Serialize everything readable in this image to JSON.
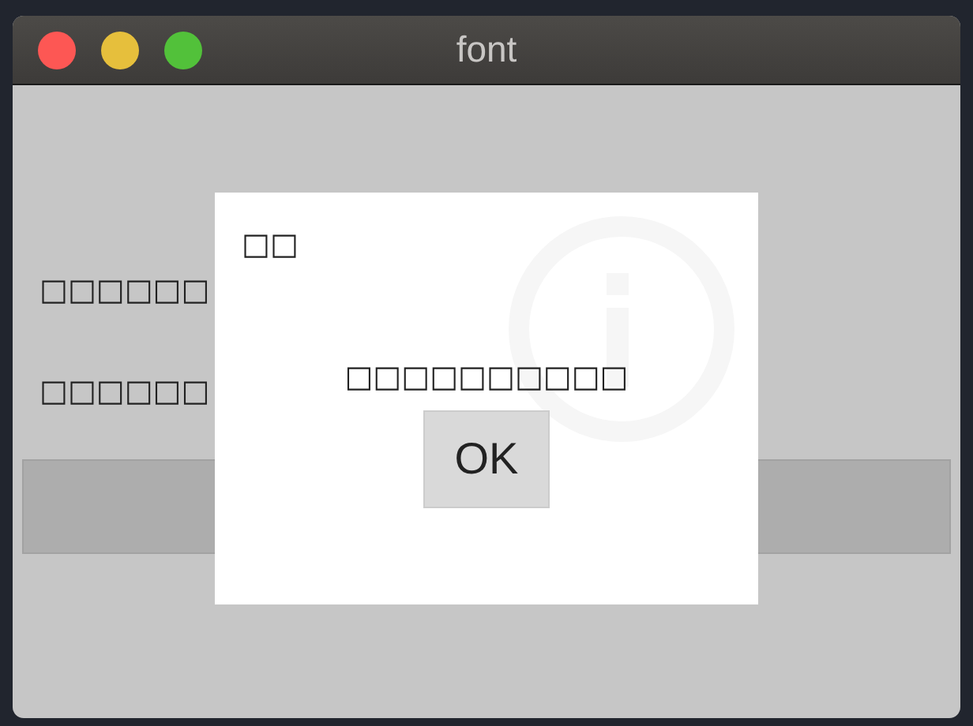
{
  "window": {
    "title": "font"
  },
  "labels": [
    "□□□□□□",
    "□□□□□□"
  ],
  "dialog": {
    "title": "□□",
    "message": "□□□□□□□□□□",
    "button": "OK"
  }
}
